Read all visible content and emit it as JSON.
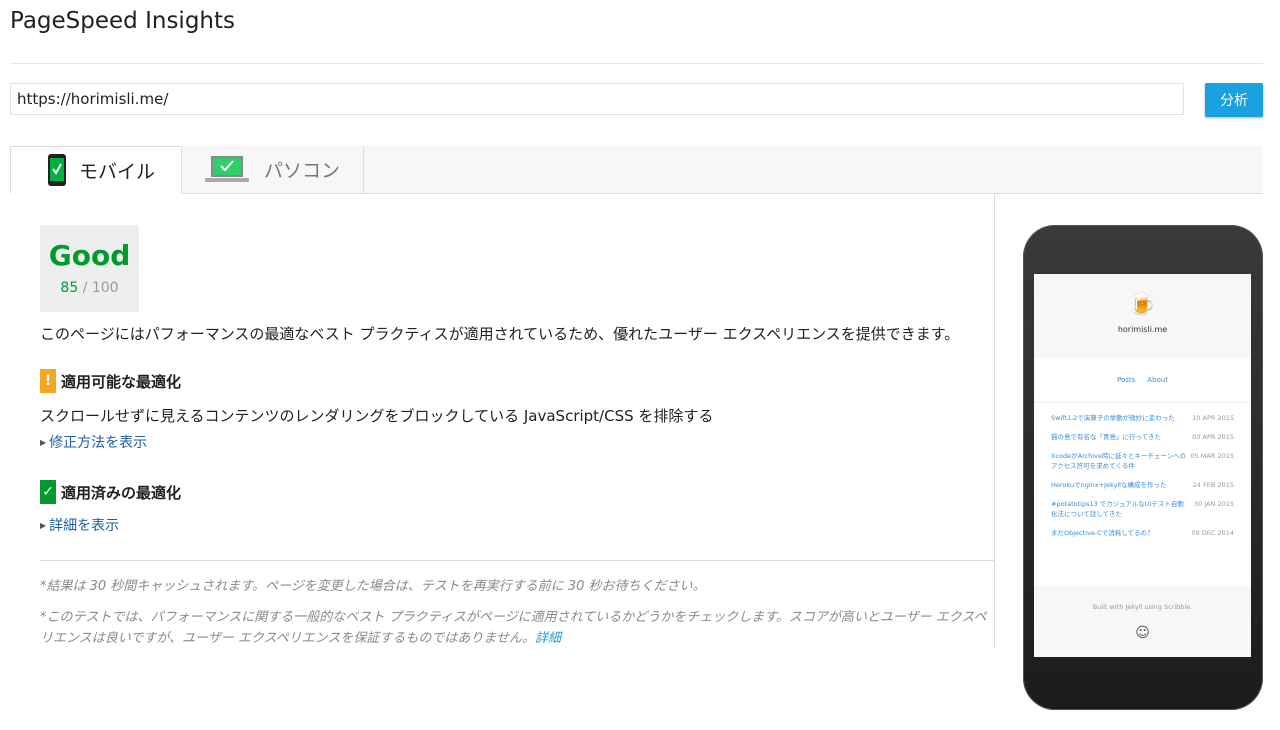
{
  "app": {
    "title": "PageSpeed Insights"
  },
  "search": {
    "url_value": "https://horimisli.me/",
    "analyze_label": "分析"
  },
  "tabs": [
    {
      "label": "モバイル",
      "icon": "mobile-check-icon",
      "active": true
    },
    {
      "label": "パソコン",
      "icon": "laptop-check-icon",
      "active": false
    }
  ],
  "score": {
    "label": "Good",
    "value": "85",
    "max": "/ 100",
    "color": "#009a2d"
  },
  "summary": "このページにはパフォーマンスの最適なベスト プラクティスが適用されているため、優れたユーザー エクスペリエンスを提供できます。",
  "sections": {
    "possible": {
      "icon": "warning-icon",
      "badge": "!",
      "title": "適用可能な最適化",
      "rule": "スクロールせずに見えるコンテンツのレンダリングをブロックしている JavaScript/CSS を排除する",
      "link": "修正方法を表示"
    },
    "applied": {
      "icon": "check-icon",
      "badge": "✓",
      "title": "適用済みの最適化",
      "link": "詳細を表示"
    }
  },
  "notes": {
    "cache": "*結果は 30 秒間キャッシュされます。ページを変更した場合は、テストを再実行する前に 30 秒お待ちください。",
    "disclaimer": "*このテストでは、パフォーマンスに関する一般的なベスト プラクティスがページに適用されているかどうかをチェックします。スコアが高いとユーザー エクスペリエンスは良いですが、ユーザー エクスペリエンスを保証するものではありません。",
    "details_link": "詳細"
  },
  "preview": {
    "site_name": "horimisli.me",
    "logo": "🍺",
    "nav": [
      "Posts",
      "About"
    ],
    "posts": [
      {
        "title": "Swift1.2で演算子の挙動が微妙に変わった",
        "date": "10 APR 2015"
      },
      {
        "title": "猫の島で有名な「青島」に行ってきた",
        "date": "03 APR 2015"
      },
      {
        "title": "XcodeがArchive時に延々とキーチェーンへのアクセス許可を求めてくる件",
        "date": "05 MAR 2015"
      },
      {
        "title": "Herokuでnginx+Jekyllな構成を作った",
        "date": "24 FEB 2015"
      },
      {
        "title": "#potatotips13 でカジュアルなUIテスト自動化法について話してきた",
        "date": "30 JAN 2015"
      },
      {
        "title": "まだObjective-Cで消耗してるの？",
        "date": "09 DEC 2014"
      }
    ],
    "footer": "Built with Jekyll using Scribble."
  }
}
